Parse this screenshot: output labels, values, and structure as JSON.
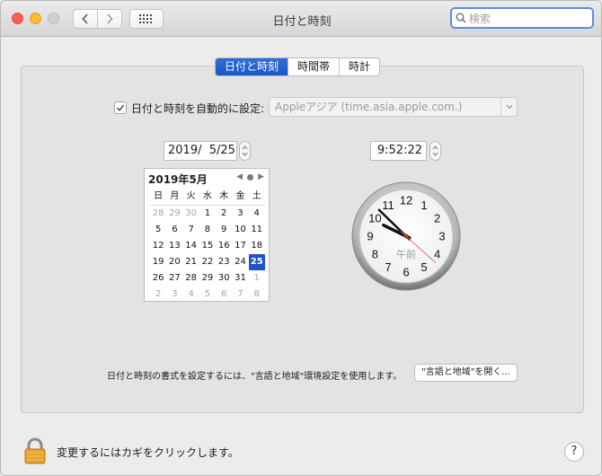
{
  "window": {
    "title": "日付と時刻",
    "search_placeholder": "検索"
  },
  "tabs": [
    {
      "label": "日付と時刻",
      "active": true
    },
    {
      "label": "時間帯",
      "active": false
    },
    {
      "label": "時計",
      "active": false
    }
  ],
  "auto": {
    "checked": true,
    "label": "日付と時刻を自動的に設定:",
    "server": "Appleアジア (time.asia.apple.com.)"
  },
  "date_field": "2019/  5/25",
  "time_field": "9:52:22",
  "calendar": {
    "month_label": "2019年5月",
    "weekdays": [
      "日",
      "月",
      "火",
      "水",
      "木",
      "金",
      "土"
    ],
    "rows": [
      [
        {
          "d": "28",
          "o": true
        },
        {
          "d": "29",
          "o": true
        },
        {
          "d": "30",
          "o": true
        },
        {
          "d": "1"
        },
        {
          "d": "2"
        },
        {
          "d": "3"
        },
        {
          "d": "4"
        }
      ],
      [
        {
          "d": "5"
        },
        {
          "d": "6"
        },
        {
          "d": "7"
        },
        {
          "d": "8"
        },
        {
          "d": "9"
        },
        {
          "d": "10"
        },
        {
          "d": "11"
        }
      ],
      [
        {
          "d": "12"
        },
        {
          "d": "13"
        },
        {
          "d": "14"
        },
        {
          "d": "15"
        },
        {
          "d": "16"
        },
        {
          "d": "17"
        },
        {
          "d": "18"
        }
      ],
      [
        {
          "d": "19"
        },
        {
          "d": "20"
        },
        {
          "d": "21"
        },
        {
          "d": "22"
        },
        {
          "d": "23"
        },
        {
          "d": "24"
        },
        {
          "d": "25",
          "sel": true
        }
      ],
      [
        {
          "d": "26"
        },
        {
          "d": "27"
        },
        {
          "d": "28"
        },
        {
          "d": "29"
        },
        {
          "d": "30"
        },
        {
          "d": "31"
        },
        {
          "d": "1",
          "o": true
        }
      ],
      [
        {
          "d": "2",
          "o": true
        },
        {
          "d": "3",
          "o": true
        },
        {
          "d": "4",
          "o": true
        },
        {
          "d": "5",
          "o": true
        },
        {
          "d": "6",
          "o": true
        },
        {
          "d": "7",
          "o": true
        },
        {
          "d": "8",
          "o": true
        }
      ]
    ]
  },
  "clock": {
    "numerals": [
      "12",
      "1",
      "2",
      "3",
      "4",
      "5",
      "6",
      "7",
      "8",
      "9",
      "10",
      "11"
    ],
    "ampm": "午前",
    "hour": 9,
    "minute": 52,
    "second": 22
  },
  "hint_text": "日付と時刻の書式を設定するには、\"言語と地域\"環境設定を使用します。",
  "open_button": "\"言語と地域\"を開く...",
  "lock_text": "変更するにはカギをクリックします。",
  "help": "?",
  "colors": {
    "accent": "#1d55c6",
    "second_hand": "#ec6f6f"
  }
}
